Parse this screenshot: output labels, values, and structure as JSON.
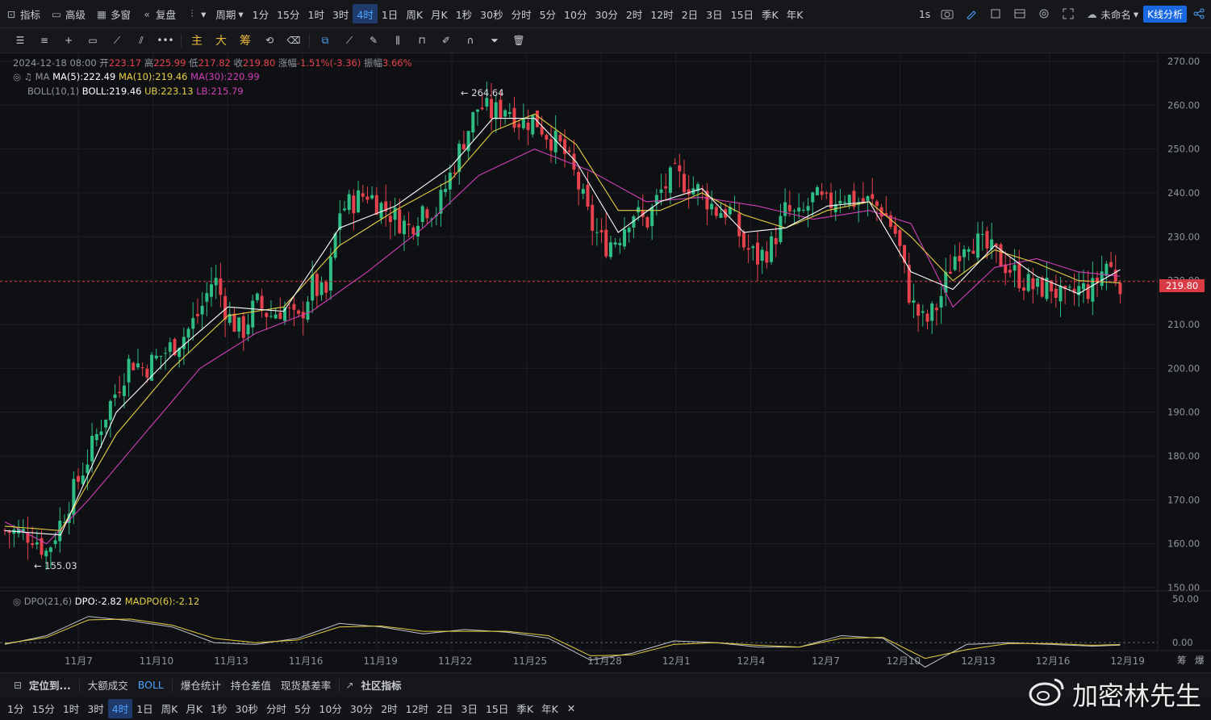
{
  "topbar": {
    "indicator_label": "指标",
    "advanced_label": "高级",
    "multi_window_label": "多窗",
    "replay_label": "复盘",
    "period_label": "周期",
    "intervals": [
      "1分",
      "15分",
      "1时",
      "3时",
      "4时",
      "1日",
      "周K",
      "月K",
      "1秒",
      "30秒",
      "分时",
      "5分",
      "10分",
      "30分",
      "2时",
      "12时",
      "2日",
      "3日",
      "15日",
      "季K",
      "年K"
    ],
    "active_interval": "4时",
    "right_speed": "1s",
    "unnamed_label": "未命名",
    "kline_analysis_label": "K线分析"
  },
  "toolbar": {
    "main_label": "主",
    "big_label": "大",
    "chip_label": "筹"
  },
  "legend": {
    "date": "2024-12-18 08:00",
    "open_label": "开",
    "open": "223.17",
    "high_label": "高",
    "high": "225.99",
    "low_label": "低",
    "low": "217.82",
    "close_label": "收",
    "close": "219.80",
    "change_label": "涨幅",
    "change": "-1.51%(-3.36)",
    "amp_label": "振幅",
    "amp": "3.66%",
    "ma_name": "MA",
    "ma5": "MA(5):222.49",
    "ma10": "MA(10):219.46",
    "ma30": "MA(30):220.99",
    "boll_name": "BOLL(10,1)",
    "boll": "BOLL:219.46",
    "ub": "UB:223.13",
    "lb": "LB:215.79",
    "dpo_name": "DPO(21,6)",
    "dpo": "DPO:-2.82",
    "madpo": "MADPO(6):-2.12"
  },
  "markers": {
    "high_marker": "← 264.64",
    "low_marker": "← 155.03",
    "last_price": "219.80"
  },
  "colors": {
    "up": "#2ebd85",
    "down": "#e5424d",
    "ma5": "#ffffff",
    "ma10": "#e6cf44",
    "ma30": "#d13fb8",
    "accent": "#1968e0"
  },
  "chart_data": {
    "type": "candlestick",
    "x_tick_labels": [
      "11月7",
      "11月10",
      "11月13",
      "11月16",
      "11月19",
      "11月22",
      "11月25",
      "11月28",
      "12月1",
      "12月4",
      "12月7",
      "12月10",
      "12月13",
      "12月16",
      "12月19"
    ],
    "y_tick_labels": [
      "270.00",
      "260.00",
      "250.00",
      "240.00",
      "230.00",
      "220.00",
      "210.00",
      "200.00",
      "190.00",
      "180.00",
      "170.00",
      "160.00",
      "150.00"
    ],
    "ylim": [
      150,
      270
    ],
    "sub_y_tick_labels": [
      "50.00",
      "0.00"
    ],
    "close_path": [
      [
        0,
        163
      ],
      [
        2,
        162
      ],
      [
        3,
        158
      ],
      [
        4,
        165
      ],
      [
        6,
        180
      ],
      [
        7,
        188
      ],
      [
        8,
        195
      ],
      [
        9,
        202
      ],
      [
        10,
        200
      ],
      [
        12,
        205
      ],
      [
        13,
        208
      ],
      [
        14,
        213
      ],
      [
        15,
        221
      ],
      [
        16,
        212
      ],
      [
        17,
        208
      ],
      [
        18,
        215
      ],
      [
        19,
        212
      ],
      [
        20,
        214
      ],
      [
        21,
        210
      ],
      [
        22,
        219
      ],
      [
        23,
        216
      ],
      [
        24,
        236
      ],
      [
        26,
        240
      ],
      [
        27,
        237
      ],
      [
        29,
        232
      ],
      [
        30,
        237
      ],
      [
        31,
        236
      ],
      [
        33,
        253
      ],
      [
        34,
        260
      ],
      [
        35,
        258
      ],
      [
        36,
        260
      ],
      [
        37,
        256
      ],
      [
        38,
        257
      ],
      [
        39,
        253
      ],
      [
        40,
        250
      ],
      [
        41,
        243
      ],
      [
        42,
        233
      ],
      [
        43,
        228
      ],
      [
        44,
        230
      ],
      [
        45,
        236
      ],
      [
        46,
        233
      ],
      [
        47,
        240
      ],
      [
        48,
        244
      ],
      [
        49,
        242
      ],
      [
        50,
        240
      ],
      [
        51,
        236
      ],
      [
        52,
        236
      ],
      [
        53,
        228
      ],
      [
        54,
        225
      ],
      [
        55,
        228
      ],
      [
        56,
        236
      ],
      [
        57,
        234
      ],
      [
        58,
        239
      ],
      [
        59,
        237
      ],
      [
        60,
        240
      ],
      [
        61,
        238
      ],
      [
        62,
        238
      ],
      [
        63,
        236
      ],
      [
        64,
        230
      ],
      [
        65,
        215
      ],
      [
        66,
        210
      ],
      [
        67,
        215
      ],
      [
        68,
        225
      ],
      [
        69,
        230
      ],
      [
        70,
        228
      ],
      [
        71,
        226
      ],
      [
        72,
        223
      ],
      [
        73,
        220
      ],
      [
        74,
        218
      ],
      [
        75,
        219
      ],
      [
        76,
        215
      ],
      [
        77,
        218
      ],
      [
        78,
        218
      ],
      [
        79,
        224
      ],
      [
        80,
        219.8
      ]
    ],
    "ma5_path": [
      [
        0,
        163
      ],
      [
        4,
        162
      ],
      [
        8,
        190
      ],
      [
        12,
        203
      ],
      [
        16,
        214
      ],
      [
        20,
        213
      ],
      [
        24,
        232
      ],
      [
        28,
        237
      ],
      [
        32,
        246
      ],
      [
        35,
        257
      ],
      [
        38,
        257
      ],
      [
        41,
        247
      ],
      [
        44,
        231
      ],
      [
        47,
        238
      ],
      [
        50,
        241
      ],
      [
        53,
        231
      ],
      [
        56,
        232
      ],
      [
        59,
        237
      ],
      [
        62,
        238
      ],
      [
        65,
        222
      ],
      [
        68,
        218
      ],
      [
        71,
        228
      ],
      [
        74,
        221
      ],
      [
        77,
        217
      ],
      [
        80,
        222.5
      ]
    ],
    "ma10_path": [
      [
        0,
        164
      ],
      [
        4,
        163
      ],
      [
        8,
        185
      ],
      [
        12,
        200
      ],
      [
        16,
        212
      ],
      [
        20,
        214
      ],
      [
        24,
        228
      ],
      [
        28,
        236
      ],
      [
        32,
        243
      ],
      [
        35,
        254
      ],
      [
        38,
        258
      ],
      [
        41,
        251
      ],
      [
        44,
        236
      ],
      [
        47,
        236
      ],
      [
        50,
        240
      ],
      [
        53,
        235
      ],
      [
        56,
        232
      ],
      [
        59,
        236
      ],
      [
        62,
        238
      ],
      [
        65,
        230
      ],
      [
        68,
        220
      ],
      [
        71,
        227
      ],
      [
        74,
        224
      ],
      [
        77,
        220
      ],
      [
        80,
        219.5
      ]
    ],
    "ma30_path": [
      [
        0,
        165
      ],
      [
        3,
        160
      ],
      [
        6,
        170
      ],
      [
        10,
        185
      ],
      [
        14,
        200
      ],
      [
        18,
        208
      ],
      [
        22,
        213
      ],
      [
        26,
        222
      ],
      [
        30,
        232
      ],
      [
        34,
        244
      ],
      [
        38,
        250
      ],
      [
        42,
        245
      ],
      [
        46,
        238
      ],
      [
        50,
        239
      ],
      [
        54,
        237
      ],
      [
        58,
        234
      ],
      [
        62,
        236
      ],
      [
        65,
        233
      ],
      [
        68,
        214
      ],
      [
        71,
        223
      ],
      [
        74,
        225
      ],
      [
        77,
        222
      ],
      [
        80,
        221
      ]
    ],
    "dpo_path": [
      [
        0,
        -2
      ],
      [
        3,
        8
      ],
      [
        6,
        30
      ],
      [
        9,
        25
      ],
      [
        12,
        18
      ],
      [
        15,
        0
      ],
      [
        18,
        -2
      ],
      [
        21,
        5
      ],
      [
        24,
        22
      ],
      [
        27,
        18
      ],
      [
        30,
        10
      ],
      [
        33,
        15
      ],
      [
        36,
        12
      ],
      [
        39,
        5
      ],
      [
        42,
        -20
      ],
      [
        45,
        -12
      ],
      [
        48,
        2
      ],
      [
        51,
        0
      ],
      [
        54,
        -5
      ],
      [
        57,
        -5
      ],
      [
        60,
        8
      ],
      [
        63,
        5
      ],
      [
        66,
        -28
      ],
      [
        69,
        -2
      ],
      [
        72,
        0
      ],
      [
        75,
        -2
      ],
      [
        78,
        -4
      ],
      [
        80,
        -2.82
      ]
    ],
    "madpo_path": [
      [
        0,
        -1
      ],
      [
        3,
        6
      ],
      [
        6,
        26
      ],
      [
        9,
        27
      ],
      [
        12,
        20
      ],
      [
        15,
        5
      ],
      [
        18,
        0
      ],
      [
        21,
        3
      ],
      [
        24,
        18
      ],
      [
        27,
        19
      ],
      [
        30,
        13
      ],
      [
        33,
        13
      ],
      [
        36,
        13
      ],
      [
        39,
        8
      ],
      [
        42,
        -15
      ],
      [
        45,
        -14
      ],
      [
        48,
        -2
      ],
      [
        51,
        0
      ],
      [
        54,
        -3
      ],
      [
        57,
        -5
      ],
      [
        60,
        5
      ],
      [
        63,
        6
      ],
      [
        66,
        -18
      ],
      [
        69,
        -8
      ],
      [
        72,
        -1
      ],
      [
        75,
        -1
      ],
      [
        78,
        -3
      ],
      [
        80,
        -2.12
      ]
    ]
  },
  "bottom_bar": {
    "locate_label": "定位到...",
    "big_deal_label": "大额成交",
    "boll_label": "BOLL",
    "liq_label": "爆仓统计",
    "oi_label": "持仓差值",
    "basis_label": "现货基差率",
    "community_label": "社区指标",
    "intervals": [
      "1分",
      "15分",
      "1时",
      "3时",
      "4时",
      "1日",
      "周K",
      "月K",
      "1秒",
      "30秒",
      "分时",
      "5分",
      "10分",
      "30分",
      "2时",
      "12时",
      "2日",
      "3日",
      "15日",
      "季K",
      "年K"
    ],
    "active_interval": "4时"
  },
  "side_labels": {
    "chip": "筹",
    "burst": "爆"
  },
  "watermark": {
    "text": "加密林先生"
  }
}
